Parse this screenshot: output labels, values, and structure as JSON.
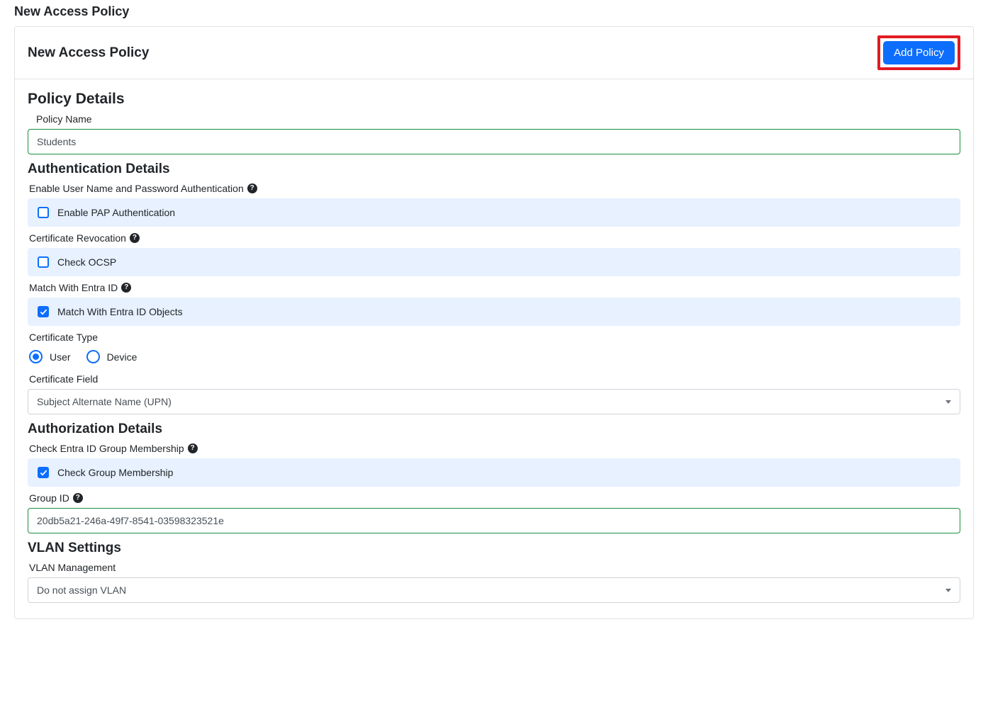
{
  "page": {
    "heading": "New Access Policy"
  },
  "panel": {
    "title": "New Access Policy",
    "add_button": "Add Policy"
  },
  "details": {
    "section_title": "Policy Details",
    "name_label": "Policy Name",
    "name_value": "Students"
  },
  "auth": {
    "section_title": "Authentication Details",
    "pap_label": "Enable User Name and Password Authentication",
    "pap_checkbox": "Enable PAP Authentication",
    "pap_checked": false,
    "revocation_label": "Certificate Revocation",
    "ocsp_checkbox": "Check OCSP",
    "ocsp_checked": false,
    "entra_label": "Match With Entra ID",
    "entra_checkbox": "Match With Entra ID Objects",
    "entra_checked": true,
    "cert_type_label": "Certificate Type",
    "radio_user": "User",
    "radio_device": "Device",
    "cert_field_label": "Certificate Field",
    "cert_field_value": "Subject Alternate Name (UPN)"
  },
  "authz": {
    "section_title": "Authorization Details",
    "group_check_label": "Check Entra ID Group Membership",
    "group_checkbox": "Check Group Membership",
    "group_checked": true,
    "group_id_label": "Group ID",
    "group_id_value": "20db5a21-246a-49f7-8541-03598323521e"
  },
  "vlan": {
    "section_title": "VLAN Settings",
    "mgmt_label": "VLAN Management",
    "mgmt_value": "Do not assign VLAN"
  }
}
